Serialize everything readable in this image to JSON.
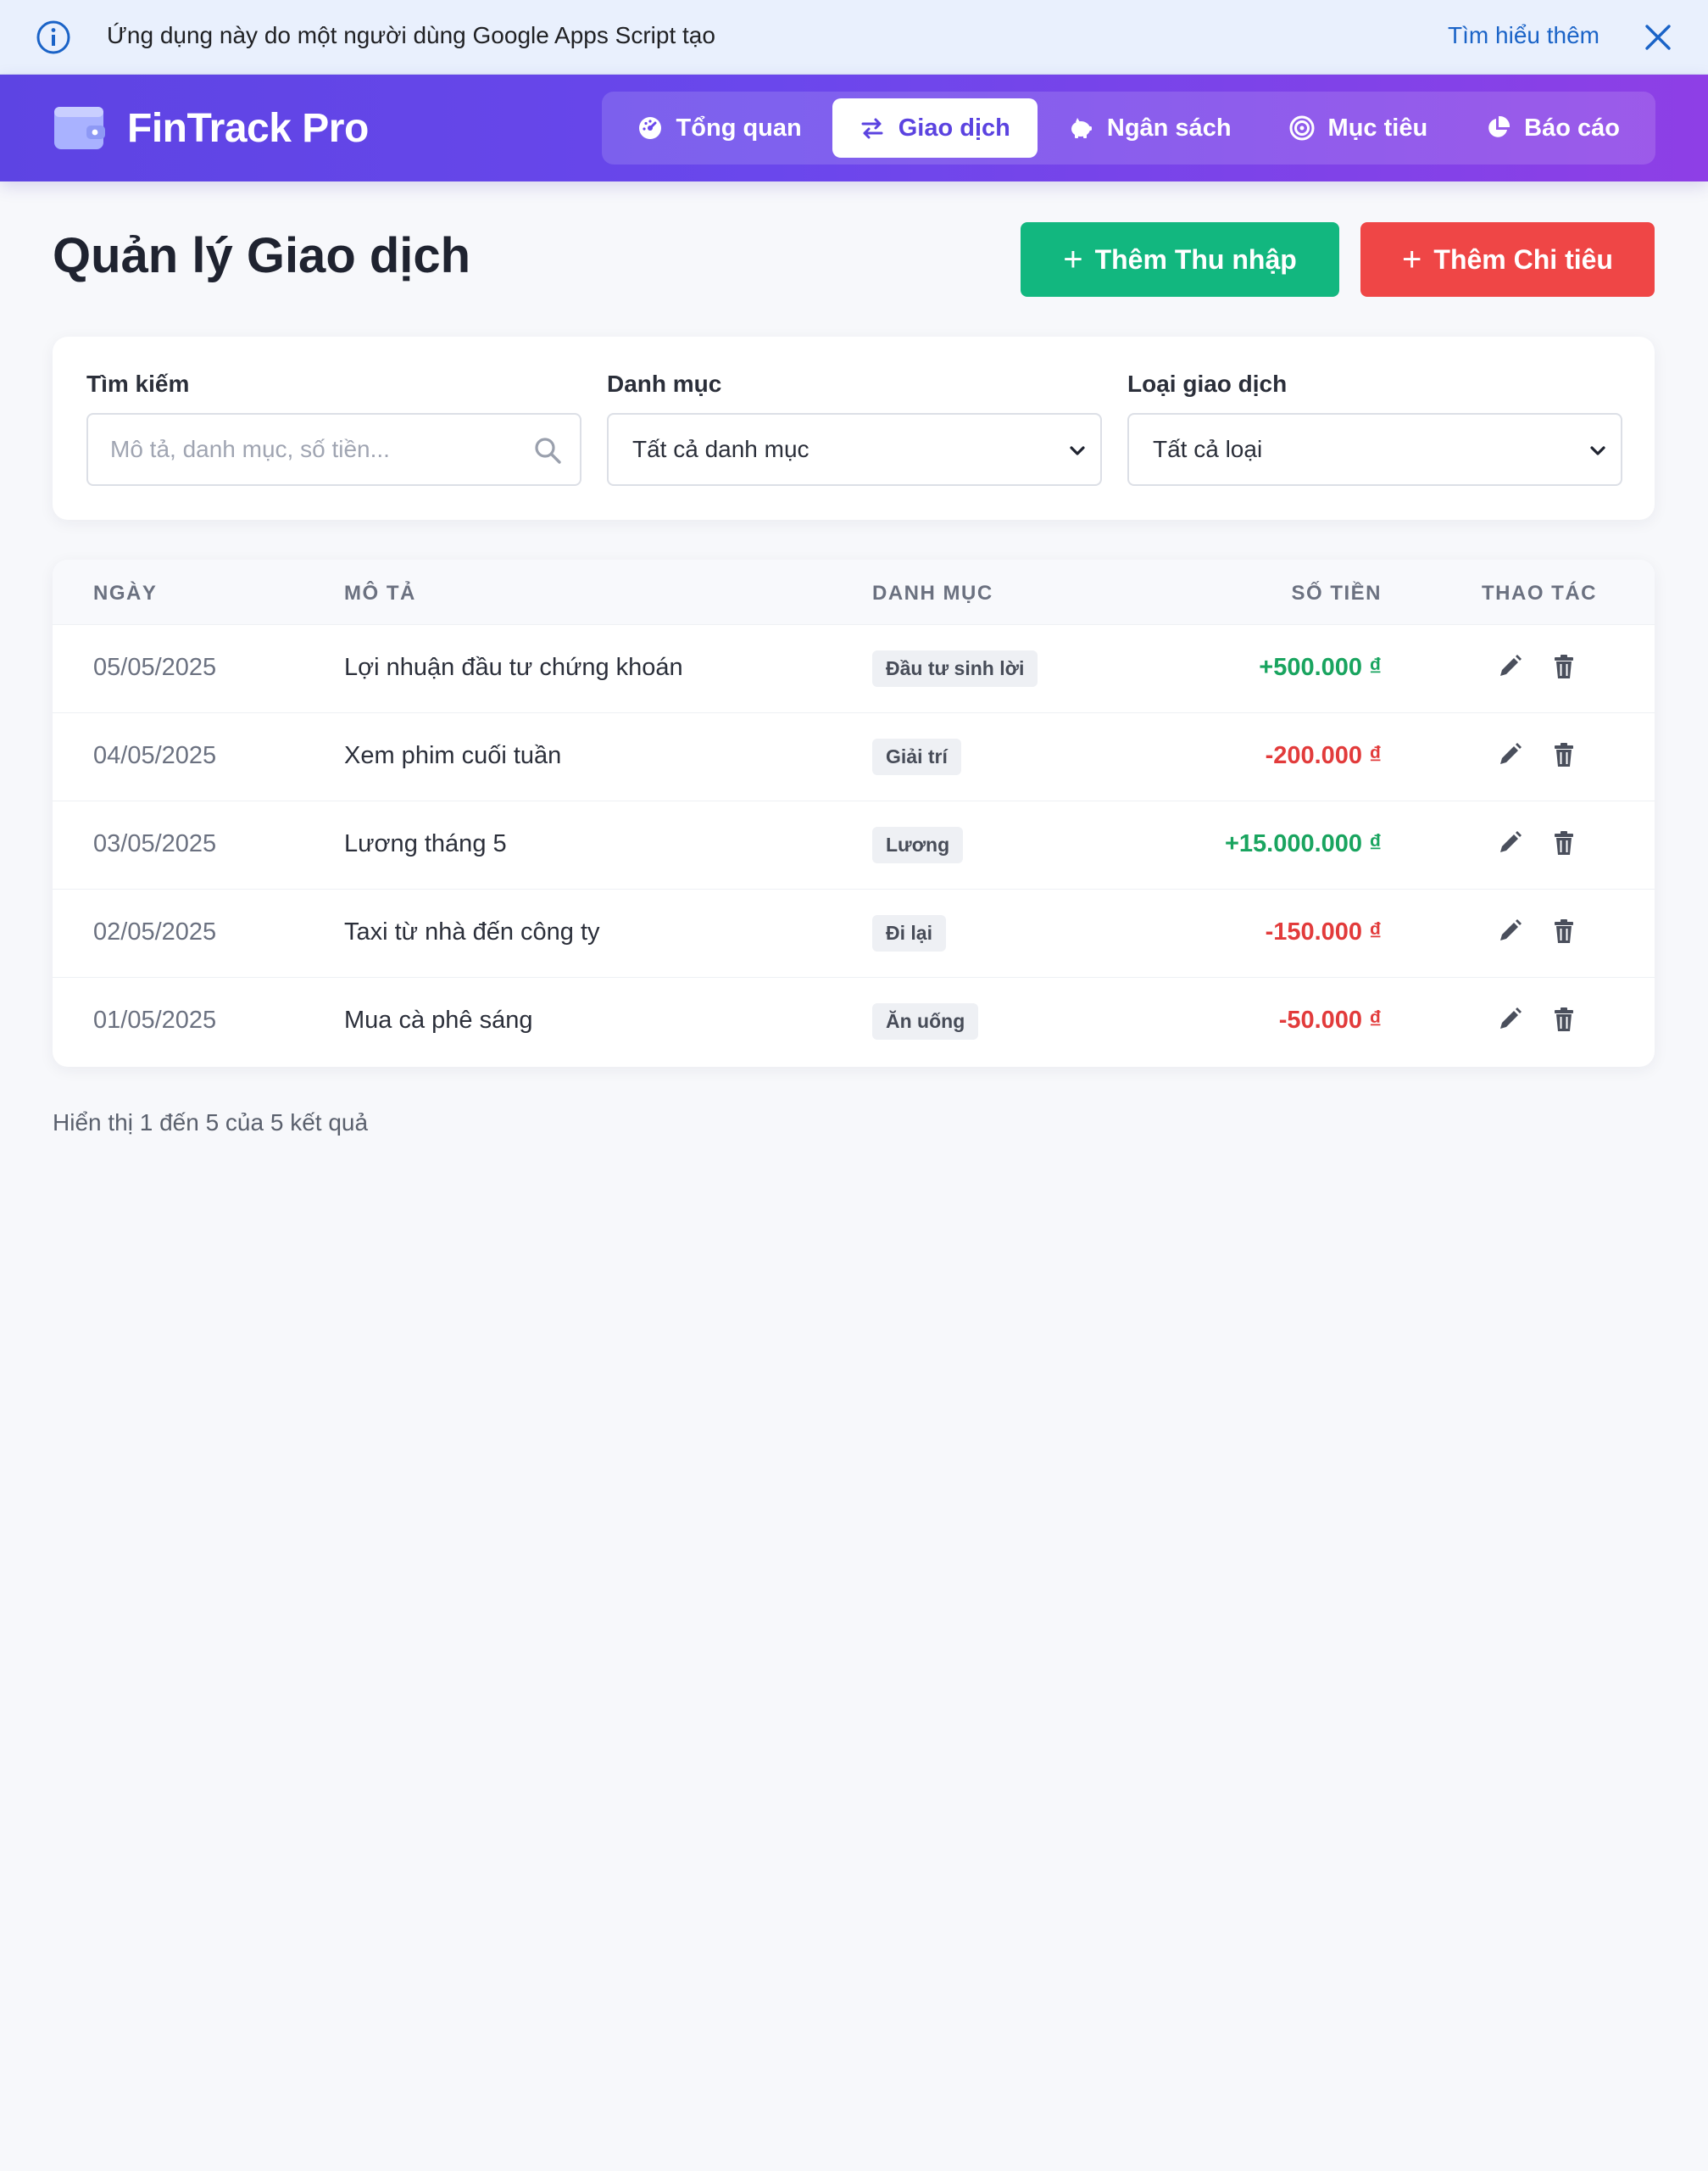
{
  "banner": {
    "message": "Ứng dụng này do một người dùng Google Apps Script tạo",
    "learn_more": "Tìm hiểu thêm"
  },
  "header": {
    "brand": "FinTrack Pro",
    "nav": [
      {
        "label": "Tổng quan",
        "icon": "gauge-icon",
        "active": false
      },
      {
        "label": "Giao dịch",
        "icon": "exchange-icon",
        "active": true
      },
      {
        "label": "Ngân sách",
        "icon": "piggy-bank-icon",
        "active": false
      },
      {
        "label": "Mục tiêu",
        "icon": "target-icon",
        "active": false
      },
      {
        "label": "Báo cáo",
        "icon": "pie-chart-icon",
        "active": false
      }
    ]
  },
  "page": {
    "title": "Quản lý Giao dịch",
    "add_income": "Thêm Thu nhập",
    "add_expense": "Thêm Chi tiêu"
  },
  "filters": {
    "search_label": "Tìm kiếm",
    "search_placeholder": "Mô tả, danh mục, số tiền...",
    "category_label": "Danh mục",
    "category_value": "Tất cả danh mục",
    "type_label": "Loại giao dịch",
    "type_value": "Tất cả loại"
  },
  "table": {
    "columns": {
      "date": "NGÀY",
      "desc": "MÔ TẢ",
      "category": "DANH MỤC",
      "amount": "SỐ TIỀN",
      "actions": "THAO TÁC"
    },
    "rows": [
      {
        "date": "05/05/2025",
        "desc": "Lợi nhuận đầu tư chứng khoán",
        "category": "Đầu tư sinh lời",
        "amount": "+500.000 ₫",
        "positive": true
      },
      {
        "date": "04/05/2025",
        "desc": "Xem phim cuối tuần",
        "category": "Giải trí",
        "amount": "-200.000 ₫",
        "positive": false
      },
      {
        "date": "03/05/2025",
        "desc": "Lương tháng 5",
        "category": "Lương",
        "amount": "+15.000.000 ₫",
        "positive": true
      },
      {
        "date": "02/05/2025",
        "desc": "Taxi từ nhà đến công ty",
        "category": "Đi lại",
        "amount": "-150.000 ₫",
        "positive": false
      },
      {
        "date": "01/05/2025",
        "desc": "Mua cà phê sáng",
        "category": "Ăn uống",
        "amount": "-50.000 ₫",
        "positive": false
      }
    ]
  },
  "footer": {
    "summary": "Hiển thị 1 đến 5 của 5 kết quả"
  },
  "colors": {
    "brand_gradient_start": "#5d44e3",
    "brand_gradient_end": "#8e3fe6",
    "income": "#12b77f",
    "expense": "#ef4646"
  }
}
